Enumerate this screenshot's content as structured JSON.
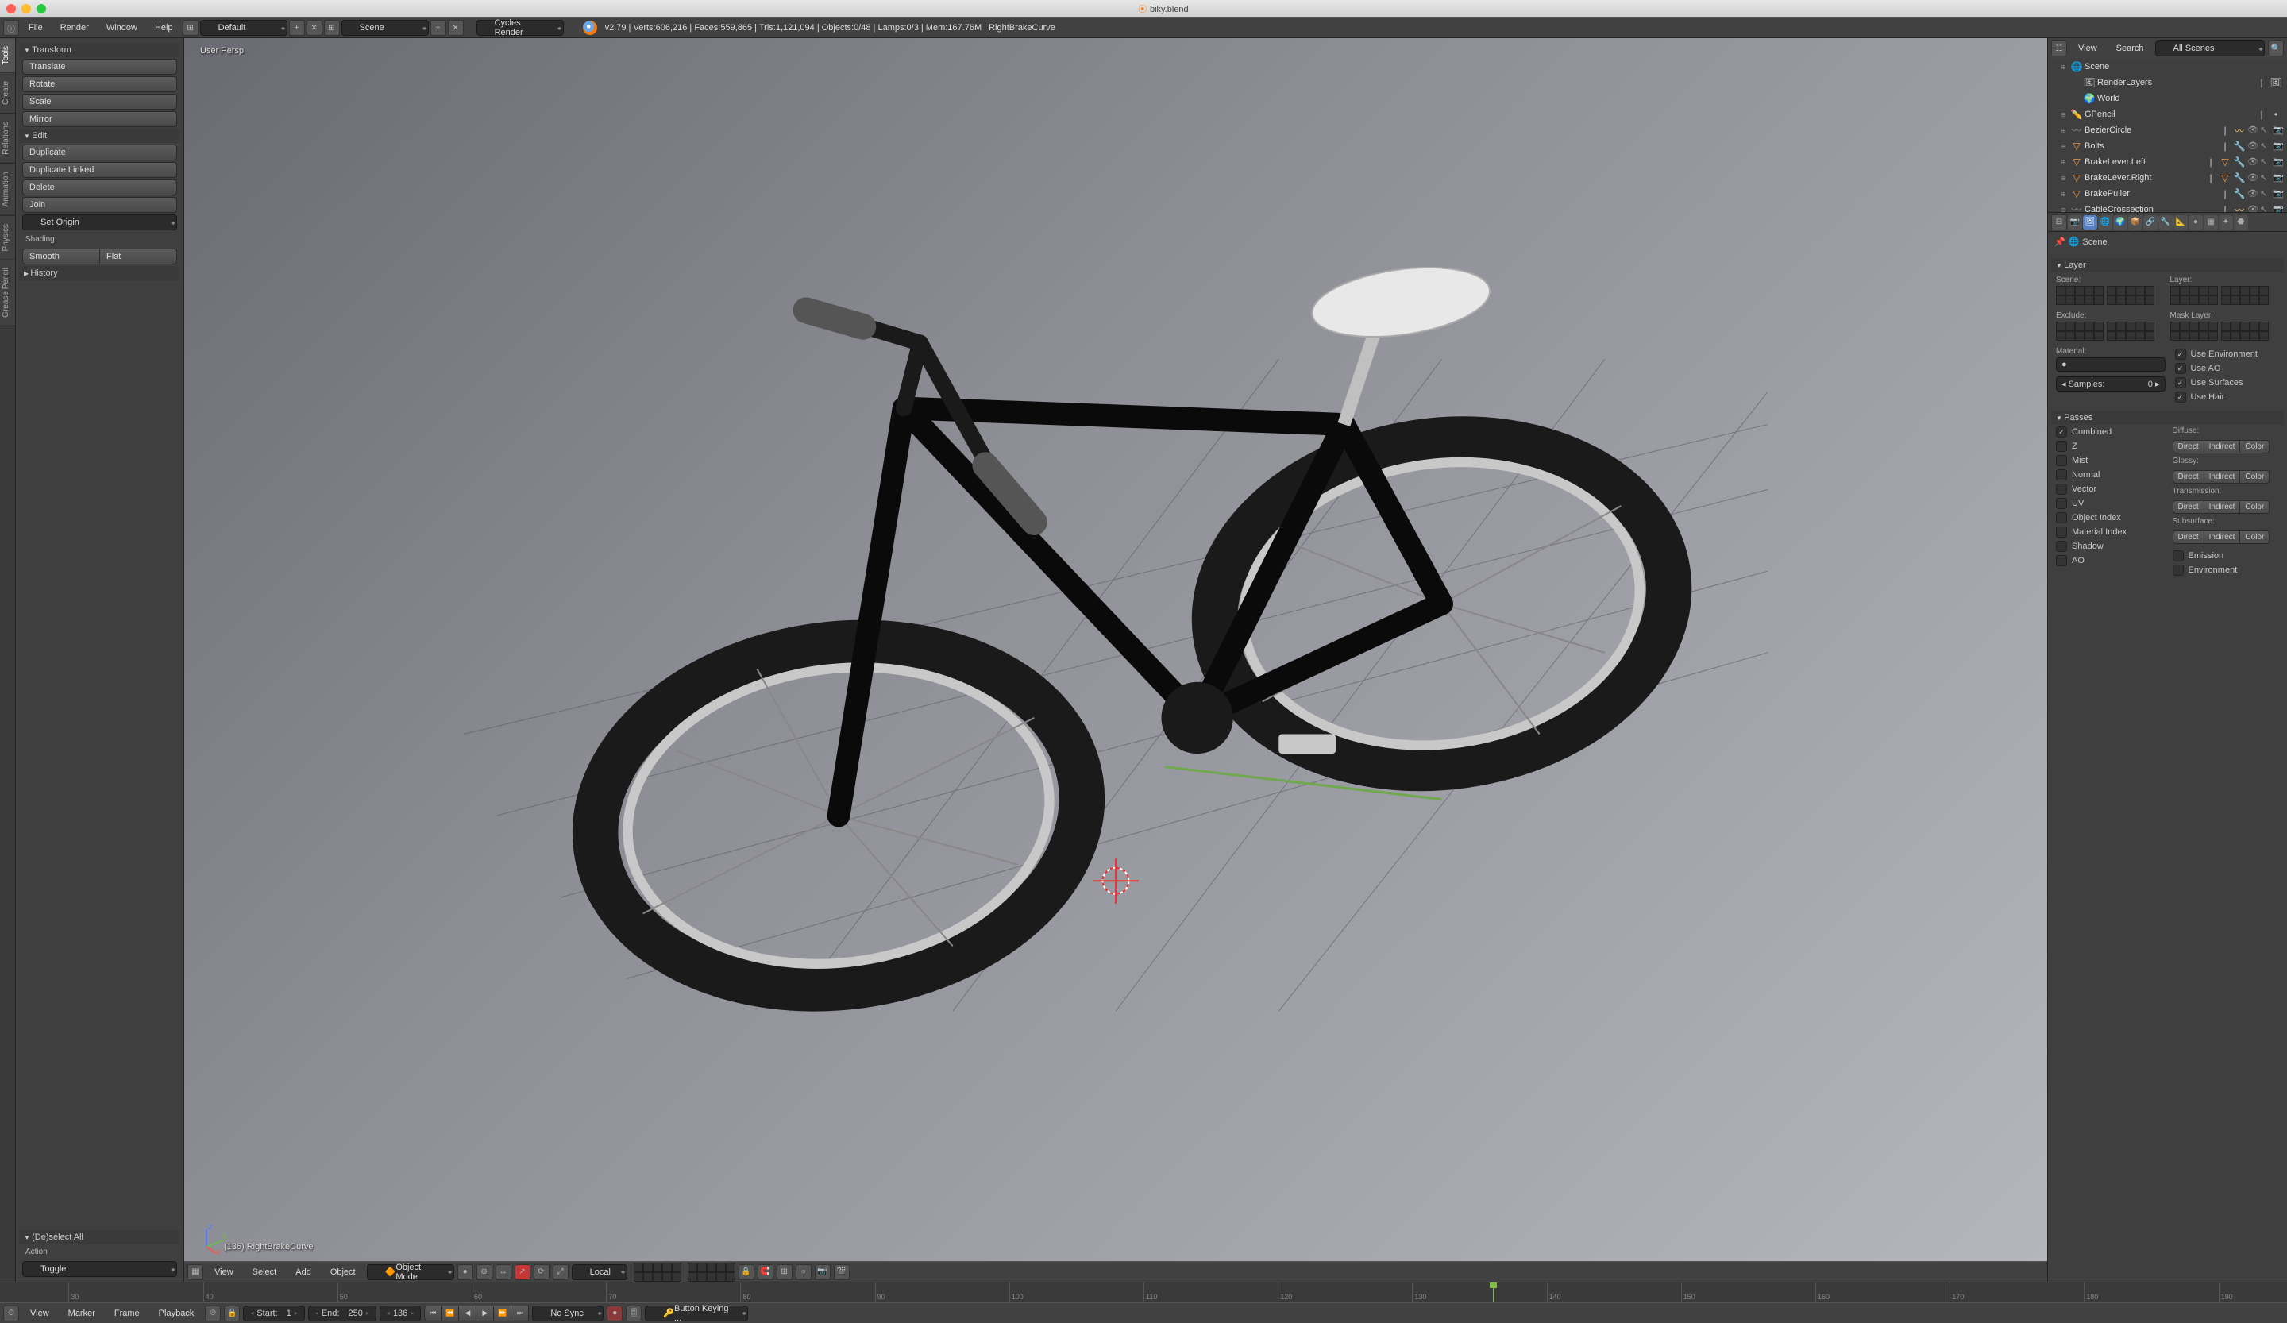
{
  "window": {
    "title": "biky.blend"
  },
  "topmenu": {
    "file": "File",
    "render": "Render",
    "window": "Window",
    "help": "Help"
  },
  "layouts": {
    "default": "Default"
  },
  "scene_dd": {
    "name": "Scene"
  },
  "engine": {
    "name": "Cycles Render"
  },
  "stats": {
    "version": "v2.79",
    "line": "Verts:606,216 | Faces:559,865 | Tris:1,121,094 | Objects:0/48 | Lamps:0/3 | Mem:167.76M | RightBrakeCurve"
  },
  "vtabs": [
    "Tools",
    "Create",
    "Relations",
    "Animation",
    "Physics",
    "Grease Pencil"
  ],
  "toolshelf": {
    "transform": {
      "title": "Transform",
      "translate": "Translate",
      "rotate": "Rotate",
      "scale": "Scale",
      "mirror": "Mirror"
    },
    "edit": {
      "title": "Edit",
      "duplicate": "Duplicate",
      "duplicate_linked": "Duplicate Linked",
      "delete": "Delete",
      "join": "Join",
      "set_origin": "Set Origin",
      "shading": "Shading:",
      "smooth": "Smooth",
      "flat": "Flat"
    },
    "history": {
      "title": "History"
    },
    "deselect": {
      "title": "(De)select All",
      "action": "Action",
      "toggle": "Toggle"
    }
  },
  "viewport": {
    "persp": "User Persp",
    "object": "(136) RightBrakeCurve"
  },
  "vp_header": {
    "view": "View",
    "select": "Select",
    "add": "Add",
    "object": "Object",
    "mode": "Object Mode",
    "orientation": "Local"
  },
  "outliner": {
    "view": "View",
    "search": "Search",
    "filter": "All Scenes",
    "items": [
      {
        "indent": 0,
        "icon": "scene",
        "name": "Scene",
        "toggles": false
      },
      {
        "indent": 1,
        "icon": "renderlayers",
        "name": "RenderLayers",
        "toggles": false,
        "extra": "img"
      },
      {
        "indent": 1,
        "icon": "world",
        "name": "World",
        "toggles": false
      },
      {
        "indent": 0,
        "icon": "gpencil",
        "name": "GPencil",
        "toggles": false,
        "extra": "dot"
      },
      {
        "indent": 0,
        "icon": "curve",
        "name": "BezierCircle",
        "toggles": true,
        "extra": "curve"
      },
      {
        "indent": 0,
        "icon": "mesh",
        "name": "Bolts",
        "toggles": true,
        "extra": "wrench"
      },
      {
        "indent": 0,
        "icon": "mesh",
        "name": "BrakeLever.Left",
        "toggles": true,
        "extra": "mesh-mod"
      },
      {
        "indent": 0,
        "icon": "mesh",
        "name": "BrakeLever.Right",
        "toggles": true,
        "extra": "mesh-mod"
      },
      {
        "indent": 0,
        "icon": "mesh",
        "name": "BrakePuller",
        "toggles": true,
        "extra": "wrench"
      },
      {
        "indent": 0,
        "icon": "curve",
        "name": "CableCrossection",
        "toggles": true,
        "extra": "curve"
      }
    ]
  },
  "props": {
    "breadcrumb": "Scene",
    "layer": {
      "title": "Layer",
      "scene": "Scene:",
      "layer": "Layer:",
      "exclude": "Exclude:",
      "mask": "Mask Layer:",
      "material": "Material:",
      "samples": "Samples:",
      "samples_val": "0",
      "use_env": "Use Environment",
      "use_ao": "Use AO",
      "use_surf": "Use Surfaces",
      "use_hair": "Use Hair"
    },
    "passes": {
      "title": "Passes",
      "combined": "Combined",
      "z": "Z",
      "mist": "Mist",
      "normal": "Normal",
      "vector": "Vector",
      "uv": "UV",
      "obj_idx": "Object Index",
      "mat_idx": "Material Index",
      "shadow": "Shadow",
      "ao": "AO",
      "diffuse": "Diffuse:",
      "glossy": "Glossy:",
      "transmission": "Transmission:",
      "subsurface": "Subsurface:",
      "emission": "Emission",
      "environment": "Environment",
      "direct": "Direct",
      "indirect": "Indirect",
      "color": "Color"
    }
  },
  "timeline": {
    "view": "View",
    "marker": "Marker",
    "frame": "Frame",
    "playback": "Playback",
    "start_label": "Start:",
    "start": "1",
    "end_label": "End:",
    "end": "250",
    "current": "136",
    "sync": "No Sync",
    "keying": "Button Keying ...",
    "ticks": [
      "30",
      "40",
      "50",
      "60",
      "70",
      "80",
      "90",
      "100",
      "110",
      "120",
      "130",
      "140",
      "150",
      "160",
      "170",
      "180",
      "190"
    ]
  }
}
